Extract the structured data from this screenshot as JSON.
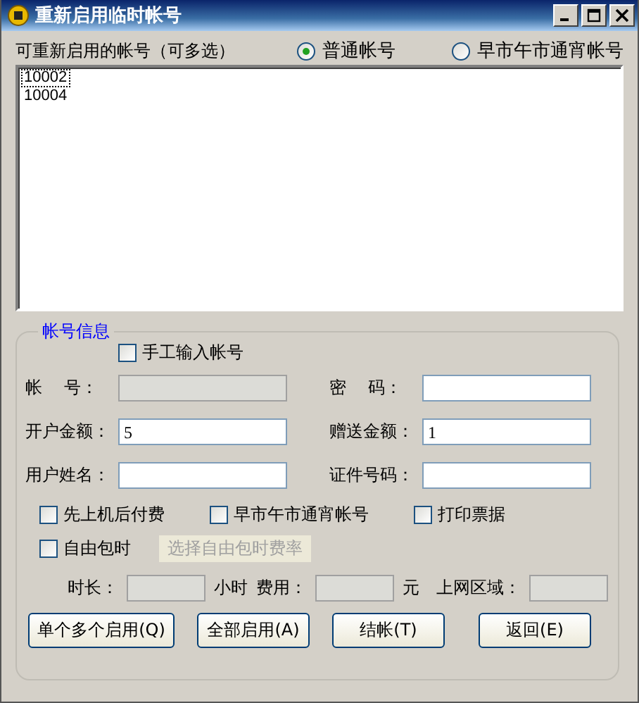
{
  "window": {
    "title": "重新启用临时帐号"
  },
  "list_label": "可重新启用的帐号（可多选）",
  "account_types": [
    {
      "label": "普通帐号",
      "selected": true
    },
    {
      "label": "早市午市通宵帐号",
      "selected": false
    }
  ],
  "accounts": [
    {
      "text": "10002",
      "focused": true
    },
    {
      "text": "10004",
      "focused": false
    }
  ],
  "group": {
    "title": "帐号信息",
    "manual_entry": {
      "label": "手工输入帐号",
      "checked": false
    },
    "fields": [
      {
        "label": "帐    号：",
        "disabled": true
      },
      {
        "label": "密    码：",
        "disabled": false
      },
      {
        "label": "开户金额：",
        "value": "5",
        "disabled": false
      },
      {
        "label": "赠送金额：",
        "value": "1",
        "disabled": false
      },
      {
        "label": "用户姓名：",
        "disabled": false
      },
      {
        "label": "证件号码：",
        "disabled": false
      }
    ],
    "options": [
      {
        "label": "先上机后付费",
        "checked": false
      },
      {
        "label": "早市午市通宵帐号",
        "checked": false
      },
      {
        "label": "打印票据",
        "checked": false
      }
    ],
    "free_package": {
      "label": "自由包时",
      "checked": false
    },
    "rate_button": {
      "label": "选择自由包时费率",
      "disabled": true
    },
    "duration": {
      "label": "时长：",
      "unit": "小时",
      "disabled": true
    },
    "cost": {
      "label": "费用：",
      "unit": "元",
      "disabled": true
    },
    "area": {
      "label": "上网区域：",
      "disabled": true
    },
    "buttons": [
      {
        "label": "单个多个启用(Q)"
      },
      {
        "label": "全部启用(A)"
      },
      {
        "label": "结帐(T)"
      },
      {
        "label": "返回(E)"
      }
    ]
  }
}
